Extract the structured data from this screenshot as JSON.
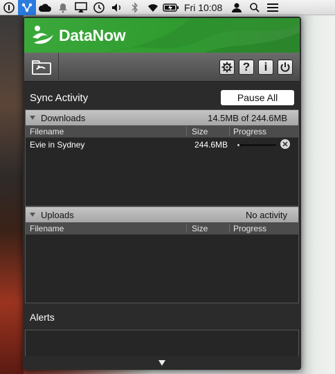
{
  "menubar": {
    "icons": [
      "info-circle-icon",
      "datanow-icon",
      "cloud-icon",
      "bell-icon",
      "airplay-icon",
      "time-machine-icon",
      "volume-icon",
      "bluetooth-icon",
      "wifi-icon",
      "battery-icon"
    ],
    "clock": "Fri 10:08",
    "right_icons": [
      "user-icon",
      "search-icon",
      "list-icon"
    ]
  },
  "app": {
    "name": "DataNow",
    "brand_color": "#3aa93a",
    "toolbar": {
      "left_icon": "sync-folder-icon",
      "buttons": [
        "gear-icon",
        "help-icon",
        "info-icon",
        "power-icon"
      ],
      "help_label": "?",
      "info_label": "i"
    }
  },
  "sync": {
    "title": "Sync Activity",
    "pause_label": "Pause All"
  },
  "downloads": {
    "title": "Downloads",
    "summary": "14.5MB of 244.6MB",
    "columns": {
      "filename": "Filename",
      "size": "Size",
      "progress": "Progress"
    },
    "rows": [
      {
        "filename": "Evie in Sydney",
        "size": "244.6MB",
        "progress": 0.06
      }
    ]
  },
  "uploads": {
    "title": "Uploads",
    "summary": "No activity",
    "columns": {
      "filename": "Filename",
      "size": "Size",
      "progress": "Progress"
    },
    "rows": []
  },
  "alerts": {
    "title": "Alerts"
  }
}
